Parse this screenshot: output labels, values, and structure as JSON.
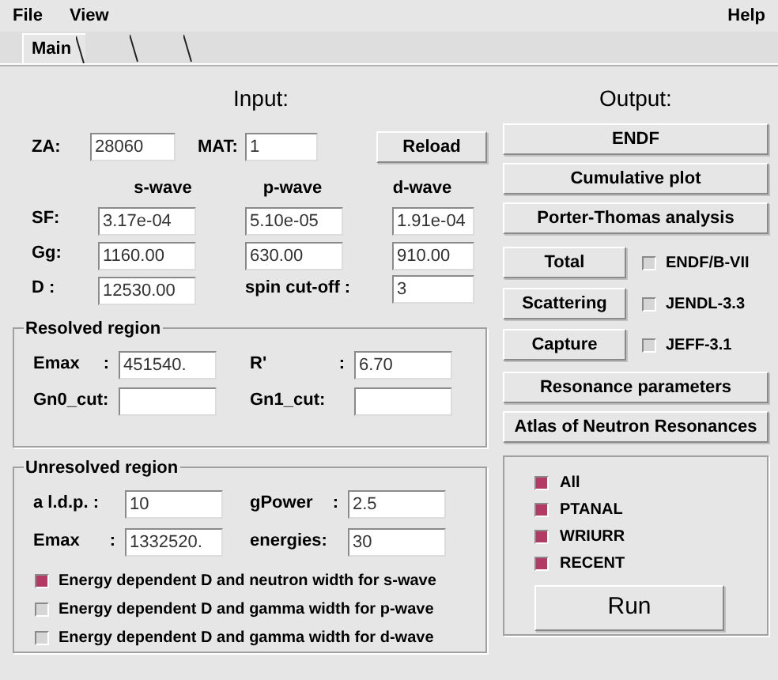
{
  "menu": {
    "left": [
      {
        "label": "File"
      },
      {
        "label": "View"
      }
    ],
    "right": [
      {
        "label": "Help"
      }
    ]
  },
  "tabs": [
    {
      "label": "Main",
      "selected": true
    },
    {
      "selected": false
    },
    {
      "selected": false
    }
  ],
  "input": {
    "title": "Input:",
    "za": {
      "label": "ZA:",
      "value": "28060"
    },
    "mat": {
      "label": "MAT:",
      "value": "1"
    },
    "reload": "Reload",
    "wave_headers": [
      "s-wave",
      "p-wave",
      "d-wave"
    ],
    "rows": [
      {
        "label": "SF:",
        "values": [
          "3.17e-04",
          "5.10e-05",
          "1.91e-04"
        ]
      },
      {
        "label": "Gg:",
        "values": [
          "1160.00",
          "630.00",
          "910.00"
        ]
      },
      {
        "label": "D :",
        "values": [
          "12530.00"
        ],
        "extra": {
          "label": "spin cut-off :",
          "value": "3"
        }
      }
    ]
  },
  "resolved": {
    "title": "Resolved region",
    "fields": [
      {
        "label": "Emax",
        "sep": ":",
        "value": "451540."
      },
      {
        "label": "R'",
        "sep": ":",
        "value": "6.70"
      },
      {
        "label": "Gn0_cut:"
      },
      {
        "label": "Gn1_cut:"
      }
    ]
  },
  "unresolved": {
    "title": "Unresolved region",
    "fields": [
      {
        "label": "a  l.d.p. :",
        "value": "10"
      },
      {
        "label": "gPower",
        "sep": ":",
        "value": "2.5"
      },
      {
        "label": "Emax",
        "sep": ":",
        "value": "1332520."
      },
      {
        "label": "energies:",
        "value": "30"
      }
    ],
    "options": [
      {
        "label": "Energy dependent D and neutron width for s-wave",
        "checked": true
      },
      {
        "label": "Energy dependent D and gamma width for p-wave",
        "checked": false
      },
      {
        "label": "Energy dependent D and gamma width for d-wave",
        "checked": false
      }
    ]
  },
  "output": {
    "title": "Output:",
    "items": [
      {
        "kind": "wide",
        "label": "ENDF"
      },
      {
        "kind": "wide",
        "label": "Cumulative plot"
      },
      {
        "kind": "wide",
        "label": "Porter-Thomas analysis"
      },
      {
        "kind": "pair",
        "label": "Total",
        "library": {
          "label": "ENDF/B-VII",
          "checked": false
        }
      },
      {
        "kind": "pair",
        "label": "Scattering",
        "library": {
          "label": "JENDL-3.3",
          "checked": false
        }
      },
      {
        "kind": "pair",
        "label": "Capture",
        "library": {
          "label": "JEFF-3.1",
          "checked": false
        }
      },
      {
        "kind": "wide",
        "label": "Resonance parameters"
      },
      {
        "kind": "wide",
        "label": "Atlas of Neutron Resonances"
      }
    ],
    "checks": [
      {
        "label": "All",
        "checked": true
      },
      {
        "label": "PTANAL",
        "checked": true
      },
      {
        "label": "WRIURR",
        "checked": true
      },
      {
        "label": "RECENT",
        "checked": true
      }
    ],
    "run": "Run"
  }
}
